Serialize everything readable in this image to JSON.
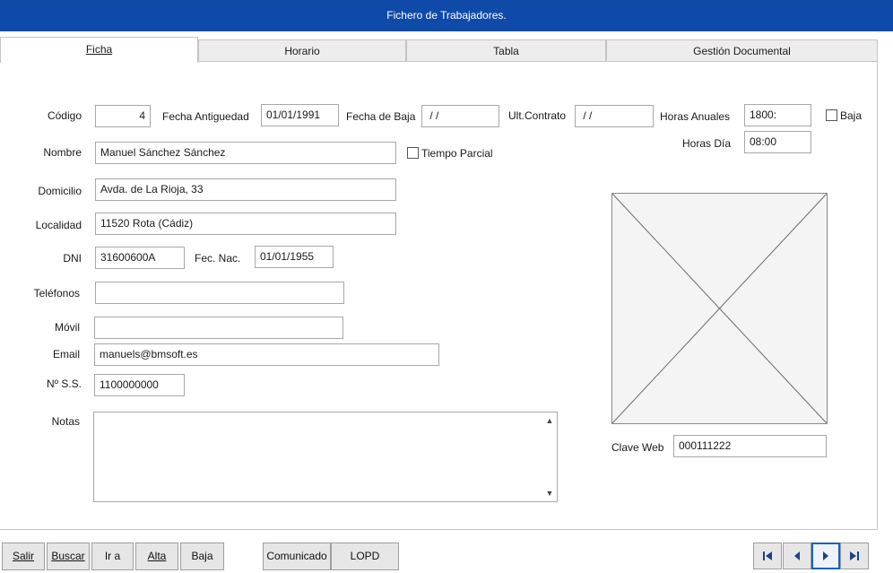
{
  "window": {
    "title": "Fichero de Trabajadores."
  },
  "tabs": [
    {
      "label": "Ficha",
      "active": true
    },
    {
      "label": "Horario",
      "active": false
    },
    {
      "label": "Tabla",
      "active": false
    },
    {
      "label": "Gestión Documental",
      "active": false
    }
  ],
  "form": {
    "codigo": {
      "label": "Código",
      "value": "4"
    },
    "fecha_antiguedad": {
      "label": "Fecha Antiguedad",
      "value": "01/01/1991"
    },
    "fecha_baja": {
      "label": "Fecha de Baja",
      "value": " / /"
    },
    "ult_contrato": {
      "label": "Ult.Contrato",
      "value": " / /"
    },
    "horas_anuales": {
      "label": "Horas Anuales",
      "value": "1800:"
    },
    "baja": {
      "label": "Baja",
      "checked": false
    },
    "horas_dia": {
      "label": "Horas Día",
      "value": "08:00"
    },
    "nombre": {
      "label": "Nombre",
      "value": "Manuel Sánchez Sánchez"
    },
    "tiempo_parcial": {
      "label": "Tiempo Parcial",
      "checked": false
    },
    "domicilio": {
      "label": "Domicilio",
      "value": "Avda. de La Rioja, 33"
    },
    "localidad": {
      "label": "Localidad",
      "value": "11520 Rota (Cádiz)"
    },
    "dni": {
      "label": "DNI",
      "value": "31600600A"
    },
    "fec_nac": {
      "label": "Fec. Nac.",
      "value": "01/01/1955"
    },
    "telefonos": {
      "label": "Teléfonos",
      "value": ""
    },
    "movil": {
      "label": "Móvil",
      "value": ""
    },
    "email": {
      "label": "Email",
      "value": "manuels@bmsoft.es"
    },
    "nss": {
      "label": "Nº S.S.",
      "value": "1100000000"
    },
    "notas": {
      "label": "Notas",
      "value": ""
    },
    "clave_web": {
      "label": "Clave Web",
      "value": "000111222"
    }
  },
  "buttons": {
    "salir": "Salir",
    "buscar": "Buscar",
    "ir_a": "Ir a",
    "alta": "Alta",
    "baja": "Baja",
    "comunicado": "Comunicado",
    "lopd": "LOPD"
  },
  "icons": {
    "scroll_up": "▲",
    "scroll_down": "▼",
    "nav_first": "first-record-icon",
    "nav_prev": "previous-record-icon",
    "nav_next": "next-record-icon",
    "nav_last": "last-record-icon"
  },
  "colors": {
    "titlebar": "#0f4aa8",
    "focus": "#1c5fc0"
  }
}
